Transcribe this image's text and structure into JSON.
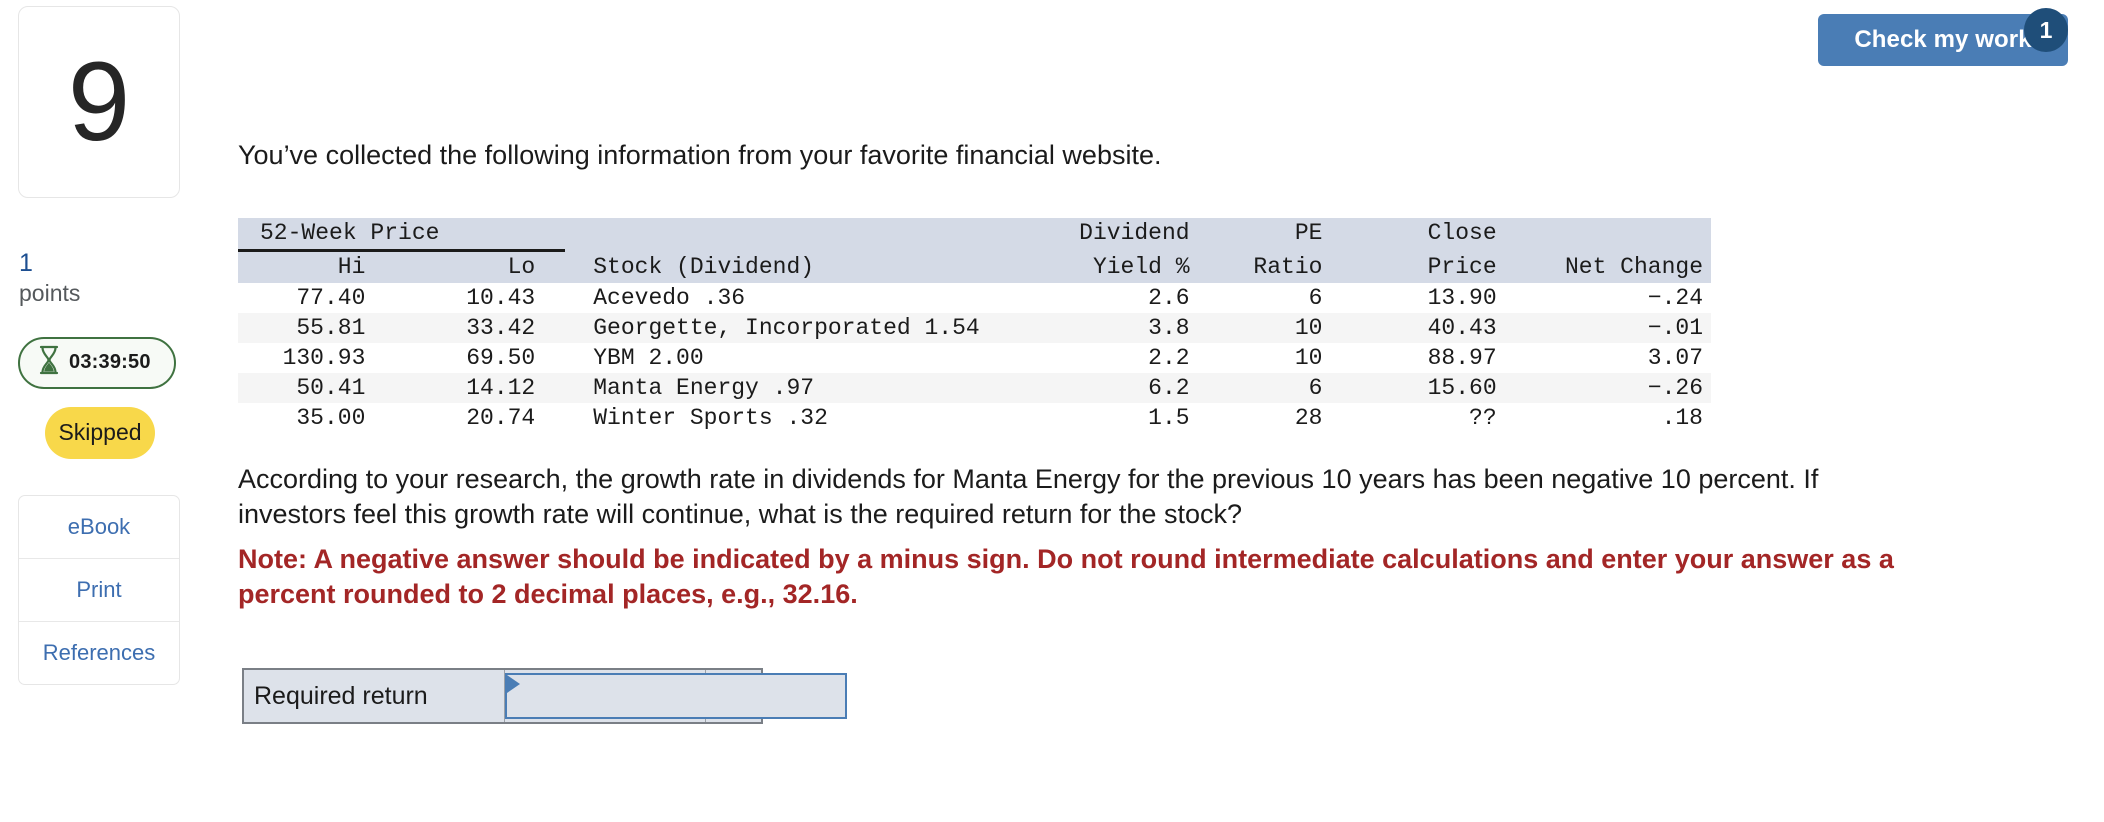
{
  "question": {
    "number": "9",
    "points_value": "1",
    "points_label": "points",
    "timer": "03:39:50",
    "status_badge": "Skipped"
  },
  "resources": {
    "items": [
      {
        "label": "eBook"
      },
      {
        "label": "Print"
      },
      {
        "label": "References"
      }
    ]
  },
  "check_work": {
    "label": "Check my work",
    "badge_count": "1",
    "button_color": "#4a7db5",
    "badge_color": "#1f4e79"
  },
  "content": {
    "intro": "You’ve collected the following information from your favorite financial website.",
    "question_text": "According to your research, the growth rate in dividends for Manta Energy for the previous 10 years has been negative 10 percent. If investors feel this growth rate will continue, what is the required return for the stock?",
    "note_text": "Note: A negative answer should be indicated by a minus sign. Do not round intermediate calculations and enter your answer as a percent rounded to 2 decimal places, e.g., 32.16.",
    "note_color": "#a32626"
  },
  "table": {
    "group_header": "52-Week Price",
    "header_top": [
      "",
      "",
      "",
      "Dividend",
      "PE",
      "Close",
      ""
    ],
    "header_bottom": [
      "Hi",
      "Lo",
      "Stock (Dividend)",
      "Yield %",
      "Ratio",
      "Price",
      "Net Change"
    ],
    "header_bg": "#d4dae6",
    "rows": [
      {
        "hi": "77.40",
        "lo": "10.43",
        "stock": "Acevedo .36",
        "yield": "2.6",
        "pe": "6",
        "close": "13.90",
        "net": "−.24"
      },
      {
        "hi": "55.81",
        "lo": "33.42",
        "stock": "Georgette, Incorporated 1.54",
        "yield": "3.8",
        "pe": "10",
        "close": "40.43",
        "net": "−.01"
      },
      {
        "hi": "130.93",
        "lo": "69.50",
        "stock": "YBM 2.00",
        "yield": "2.2",
        "pe": "10",
        "close": "88.97",
        "net": "3.07"
      },
      {
        "hi": "50.41",
        "lo": "14.12",
        "stock": "Manta Energy .97",
        "yield": "6.2",
        "pe": "6",
        "close": "15.60",
        "net": "−.26"
      },
      {
        "hi": "35.00",
        "lo": "20.74",
        "stock": "Winter Sports .32",
        "yield": "1.5",
        "pe": "28",
        "close": "??",
        "net": ".18"
      }
    ]
  },
  "answer": {
    "label": "Required return",
    "value": "",
    "placeholder": "",
    "unit": "%"
  }
}
